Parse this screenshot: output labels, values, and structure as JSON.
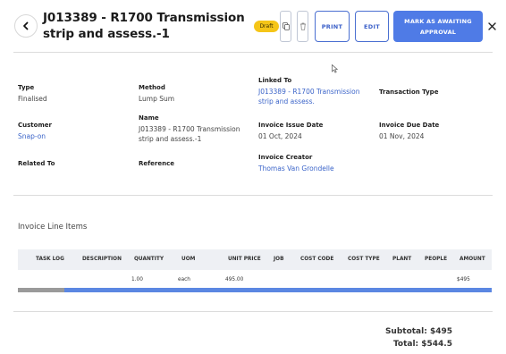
{
  "header": {
    "title": "J013389 - R1700 Transmission strip and assess.-1",
    "status_badge": "Draft",
    "print_label": "PRINT",
    "edit_label": "EDIT",
    "primary_label": "MARK AS AWAITING APPROVAL"
  },
  "details": {
    "type": {
      "label": "Type",
      "value": "Finalised"
    },
    "method": {
      "label": "Method",
      "value": "Lump Sum"
    },
    "linked_to": {
      "label": "Linked To",
      "value": "J013389 - R1700 Transmission strip and assess."
    },
    "transaction_type": {
      "label": "Transaction Type",
      "value": ""
    },
    "customer": {
      "label": "Customer",
      "value": "Snap-on"
    },
    "name": {
      "label": "Name",
      "value": "J013389 - R1700 Transmission strip and assess.-1"
    },
    "issue_date": {
      "label": "Invoice Issue Date",
      "value": "01 Oct, 2024"
    },
    "due_date": {
      "label": "Invoice Due Date",
      "value": "01 Nov, 2024"
    },
    "related_to": {
      "label": "Related To",
      "value": ""
    },
    "reference": {
      "label": "Reference",
      "value": ""
    },
    "creator": {
      "label": "Invoice Creator",
      "value": "Thomas Van Grondelle"
    }
  },
  "line_items": {
    "title": "Invoice Line Items",
    "columns": [
      "TASK LOG",
      "DESCRIPTION",
      "QUANTITY",
      "UOM",
      "UNIT PRICE",
      "JOB",
      "COST CODE",
      "COST TYPE",
      "PLANT",
      "PEOPLE",
      "AMOUNT"
    ],
    "rows": [
      {
        "task_log": "",
        "description": "",
        "quantity": "1.00",
        "uom": "each",
        "unit_price": "495.00",
        "job": "",
        "cost_code": "",
        "cost_type": "",
        "plant": "",
        "people": "",
        "amount": "$495"
      }
    ]
  },
  "totals": {
    "subtotal": "Subtotal: $495",
    "total": "Total: $544.5"
  },
  "icons": [
    "back-arrow-icon",
    "copy-icon",
    "trash-icon",
    "close-icon",
    "mouse-cursor-icon"
  ],
  "colors": {
    "accent": "#4f7be6",
    "link": "#3b64c9",
    "badge": "#f5c518"
  }
}
